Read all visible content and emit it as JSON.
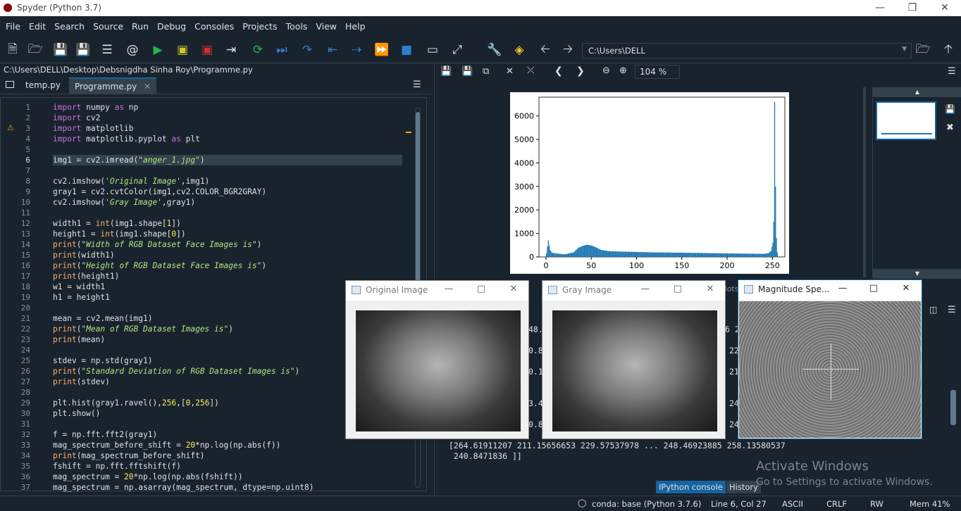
{
  "window": {
    "title": "Spyder (Python 3.7)"
  },
  "menu": [
    "File",
    "Edit",
    "Search",
    "Source",
    "Run",
    "Debug",
    "Consoles",
    "Projects",
    "Tools",
    "View",
    "Help"
  ],
  "toolbar": {
    "path": "C:\\Users\\DELL"
  },
  "editor": {
    "filepath": "C:\\Users\\DELL\\Desktop\\Debsnigdha Sinha Roy\\Programme.py",
    "tabs": [
      "temp.py",
      "Programme.py"
    ],
    "lines": [
      "import numpy as np",
      "import cv2",
      "import matplotlib",
      "import matplotlib.pyplot as plt",
      "",
      "img1 = cv2.imread(\"anger_1.jpg\")",
      "",
      "cv2.imshow('Original Image',img1)",
      "gray1 = cv2.cvtColor(img1,cv2.COLOR_BGR2GRAY)",
      "cv2.imshow('Gray Image',gray1)",
      "",
      "width1 = int(img1.shape[1])",
      "height1 = int(img1.shape[0])",
      "print(\"Width of RGB Dataset Face Images is\")",
      "print(width1)",
      "print(\"Height of RGB Dataset Face Images is\")",
      "print(height1)",
      "w1 = width1",
      "h1 = height1",
      "",
      "mean = cv2.mean(img1)",
      "print(\"Mean of RGB Dataset Images is\")",
      "print(mean)",
      "",
      "stdev = np.std(gray1)",
      "print(\"Standard Deviation of RGB Dataset Images is\")",
      "print(stdev)",
      "",
      "plt.hist(gray1.ravel(),256,[0,256])",
      "plt.show()",
      "",
      "f = np.fft.fft2(gray1)",
      "mag_spectrum_before_shift = 20*np.log(np.abs(f))",
      "print(mag_spectrum_before_shift)",
      "fshift = np.fft.fftshift(f)",
      "mag_spectrum = 20*np.log(np.abs(fshift))",
      "mag_spectrum = np.asarray(mag_spectrum, dtype=np.uint8)"
    ]
  },
  "plots": {
    "zoom": "104 %"
  },
  "chart_data": {
    "type": "bar",
    "title": "",
    "xlabel": "",
    "ylabel": "",
    "xticks": [
      "0",
      "50",
      "100",
      "150",
      "200",
      "250"
    ],
    "yticks": [
      "0",
      "1000",
      "2000",
      "3000",
      "4000",
      "5000",
      "6000"
    ],
    "xlim": [
      0,
      256
    ],
    "ylim": [
      0,
      6800
    ],
    "x": [
      0,
      2,
      4,
      6,
      10,
      20,
      30,
      35,
      40,
      45,
      50,
      55,
      60,
      70,
      80,
      100,
      120,
      150,
      180,
      200,
      220,
      240,
      245,
      248,
      250,
      251,
      252,
      253,
      254,
      255
    ],
    "values": [
      150,
      700,
      300,
      180,
      150,
      110,
      190,
      380,
      470,
      520,
      480,
      400,
      300,
      240,
      230,
      210,
      190,
      180,
      160,
      150,
      140,
      130,
      160,
      250,
      600,
      1500,
      6600,
      3000,
      800,
      200
    ]
  },
  "cv_windows": [
    {
      "title": "Original Image"
    },
    {
      "title": "Gray Image"
    },
    {
      "title": "Magnitude Spe..."
    }
  ],
  "console": {
    "line1": "[264.61911207 211.15656653 229.57537978 ... 248.46923885 258.13580537",
    "line2": " 240.8471836 ]]",
    "partial_left": [
      "48.",
      "0.8",
      "0.1",
      "3.4",
      "0.8"
    ],
    "partial_right": [
      "6 2",
      "22",
      "21",
      "24",
      "24"
    ],
    "plots_label": "Plots",
    "tabs": [
      "IPython console",
      "History"
    ],
    "watermark_title": "Activate Windows",
    "watermark_sub": "Go to Settings to activate Windows."
  },
  "status": {
    "env": "conda: base (Python 3.7.6)",
    "cursor": "Line 6, Col 27",
    "encoding": "ASCII",
    "eol": "CRLF",
    "rw": "RW",
    "mem": "Mem 41%"
  }
}
